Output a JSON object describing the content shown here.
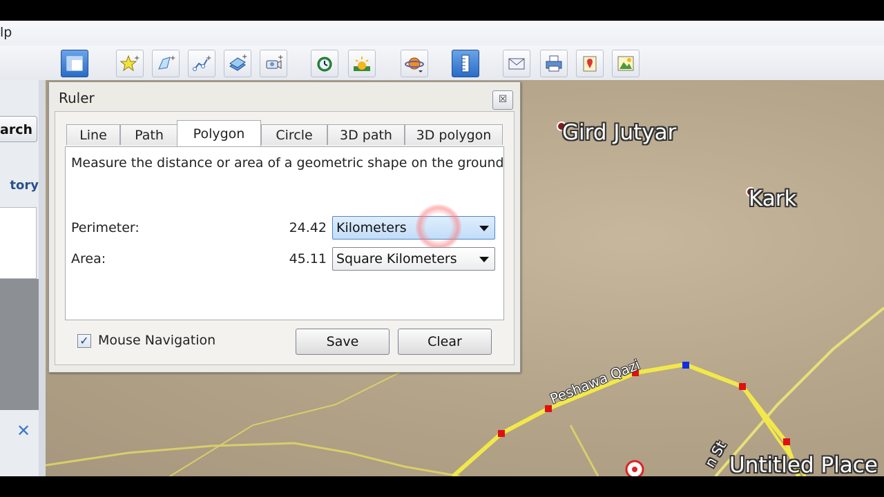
{
  "menubar": {
    "menu_fragment": "lp"
  },
  "toolbar": {
    "buttons": [
      {
        "name": "sidebar-toggle-button",
        "icon": "sidebar-icon"
      },
      {
        "name": "add-placemark-button",
        "icon": "placemark-icon"
      },
      {
        "name": "add-polygon-button",
        "icon": "polygon-icon"
      },
      {
        "name": "add-path-button",
        "icon": "path-icon"
      },
      {
        "name": "add-image-overlay-button",
        "icon": "image-overlay-icon"
      },
      {
        "name": "record-tour-button",
        "icon": "record-tour-icon"
      },
      {
        "name": "historical-imagery-button",
        "icon": "clock-icon"
      },
      {
        "name": "sunlight-button",
        "icon": "sun-icon"
      },
      {
        "name": "switch-planet-button",
        "icon": "planet-icon"
      },
      {
        "name": "ruler-button",
        "icon": "ruler-icon"
      },
      {
        "name": "email-button",
        "icon": "email-icon"
      },
      {
        "name": "print-button",
        "icon": "print-icon"
      },
      {
        "name": "view-in-maps-button",
        "icon": "maps-icon"
      },
      {
        "name": "save-image-button",
        "icon": "save-image-icon"
      }
    ]
  },
  "left_panel": {
    "search_label": "arch",
    "history_label": "tory",
    "close_glyph": "✕"
  },
  "map": {
    "places": [
      {
        "label": "Gird Jutyar"
      },
      {
        "label": "Kark"
      },
      {
        "label": "Untitled Place"
      }
    ],
    "road_label": "Peshawa Qazi",
    "street_fragment": "n St",
    "colors": {
      "road": "#f2e84a",
      "vertex": "#e01010",
      "active_vertex": "#1030e0"
    }
  },
  "ruler": {
    "title": "Ruler",
    "close_glyph": "☒",
    "tabs": [
      {
        "label": "Line"
      },
      {
        "label": "Path"
      },
      {
        "label": "Polygon",
        "selected": true
      },
      {
        "label": "Circle"
      },
      {
        "label": "3D path"
      },
      {
        "label": "3D polygon"
      }
    ],
    "description": "Measure the distance or area of a geometric shape on the ground",
    "perimeter": {
      "label": "Perimeter:",
      "value": "24.42",
      "unit": "Kilometers"
    },
    "area": {
      "label": "Area:",
      "value": "45.11",
      "unit": "Square Kilometers"
    },
    "mouse_navigation": {
      "label": "Mouse Navigation",
      "checked": true,
      "check_glyph": "✓"
    },
    "save_label": "Save",
    "clear_label": "Clear"
  }
}
